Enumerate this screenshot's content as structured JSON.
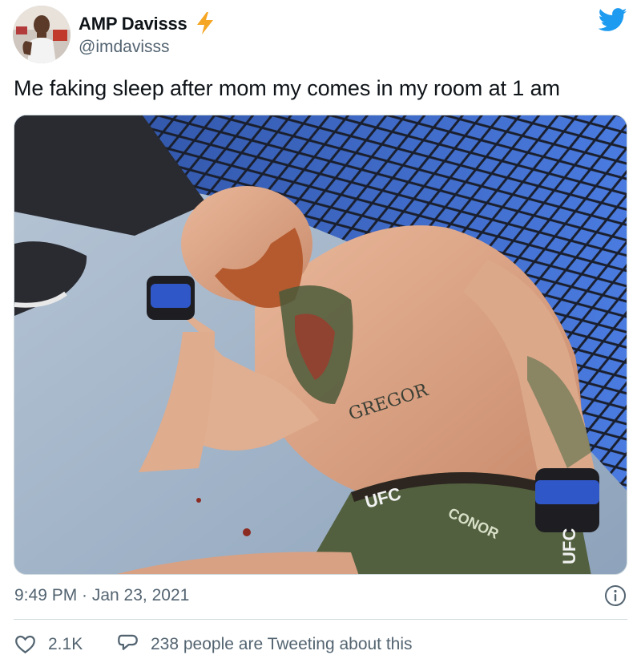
{
  "author": {
    "display_name": "AMP Davisss",
    "handle": "@imdavisss",
    "name_emoji": "lightning-bolt-icon"
  },
  "brand": {
    "icon": "twitter-bird-icon",
    "color": "#1d9bf0"
  },
  "tweet": {
    "text": "Me faking sleep after mom my comes in my room at 1 am",
    "media": {
      "kind": "photo",
      "overlay_text": [
        "GREGOR",
        "UFC",
        "CONOR",
        "UFC"
      ]
    }
  },
  "meta": {
    "timestamp": "9:49 PM · Jan 23, 2021",
    "info_icon": "info-icon"
  },
  "actions": {
    "like_count": "2.1K",
    "tweeting_text": "238 people are Tweeting about this"
  },
  "colors": {
    "text_primary": "#0f1419",
    "text_secondary": "#536471",
    "divider": "#cfd9de",
    "bolt": "#f5a623"
  }
}
